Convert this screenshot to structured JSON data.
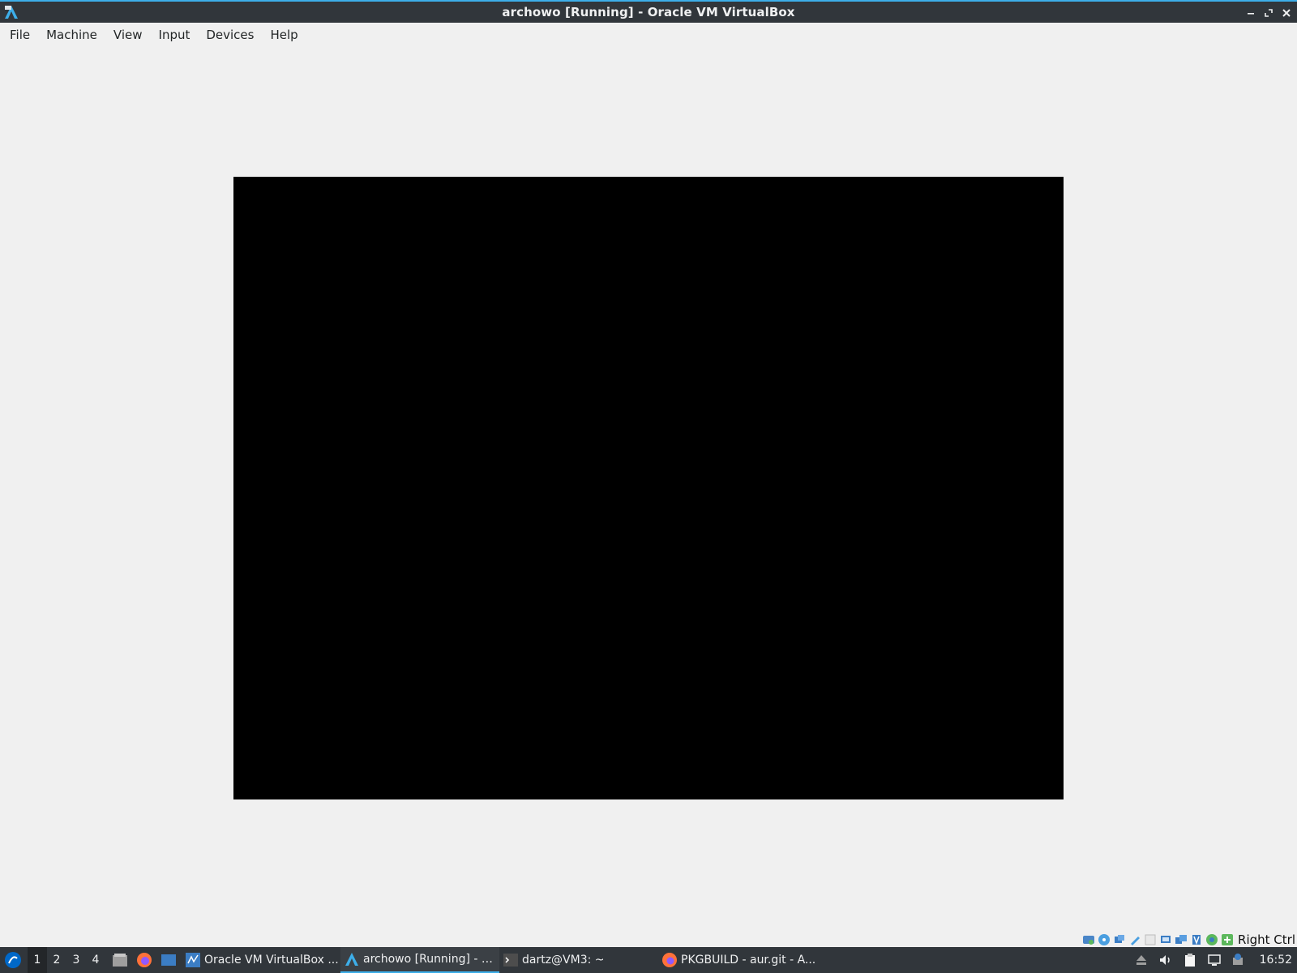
{
  "window": {
    "title": "archowo [Running] - Oracle VM VirtualBox",
    "controls": [
      "minimize",
      "maximize",
      "close"
    ]
  },
  "menubar": {
    "items": [
      "File",
      "Machine",
      "View",
      "Input",
      "Devices",
      "Help"
    ]
  },
  "vbox_status": {
    "indicators": [
      "hard-disk-icon",
      "optical-drive-icon",
      "audio-icon",
      "network-icon",
      "usb-icon",
      "shared-folders-icon",
      "display-icon",
      "recording-icon",
      "vt-x-icon",
      "mouse-integration-icon",
      "keyboard-icon"
    ],
    "host_key": "Right Ctrl"
  },
  "taskbar": {
    "desktops": [
      "1",
      "2",
      "3",
      "4"
    ],
    "active_desktop": "1",
    "launchers": [
      "file-manager-icon",
      "firefox-icon",
      "desktop-icon"
    ],
    "tasks": [
      {
        "label": "Oracle VM VirtualBox ...",
        "icon": "virtualbox-manager-icon"
      },
      {
        "label": "archowo [Running] - O...",
        "icon": "virtualbox-vm-icon",
        "active": true
      },
      {
        "label": "dartz@VM3: ~",
        "icon": "terminal-icon"
      },
      {
        "label": "PKGBUILD - aur.git - A...",
        "icon": "firefox-icon"
      }
    ],
    "tray": [
      "removable-media-icon",
      "volume-icon",
      "clipboard-icon",
      "network-tray-icon",
      "update-notifier-icon"
    ],
    "clock": "16:52"
  },
  "colors": {
    "titlebar": "#31363b",
    "accent": "#3daee9",
    "window_bg": "#f0f0f0",
    "vm_screen": "#000000"
  }
}
